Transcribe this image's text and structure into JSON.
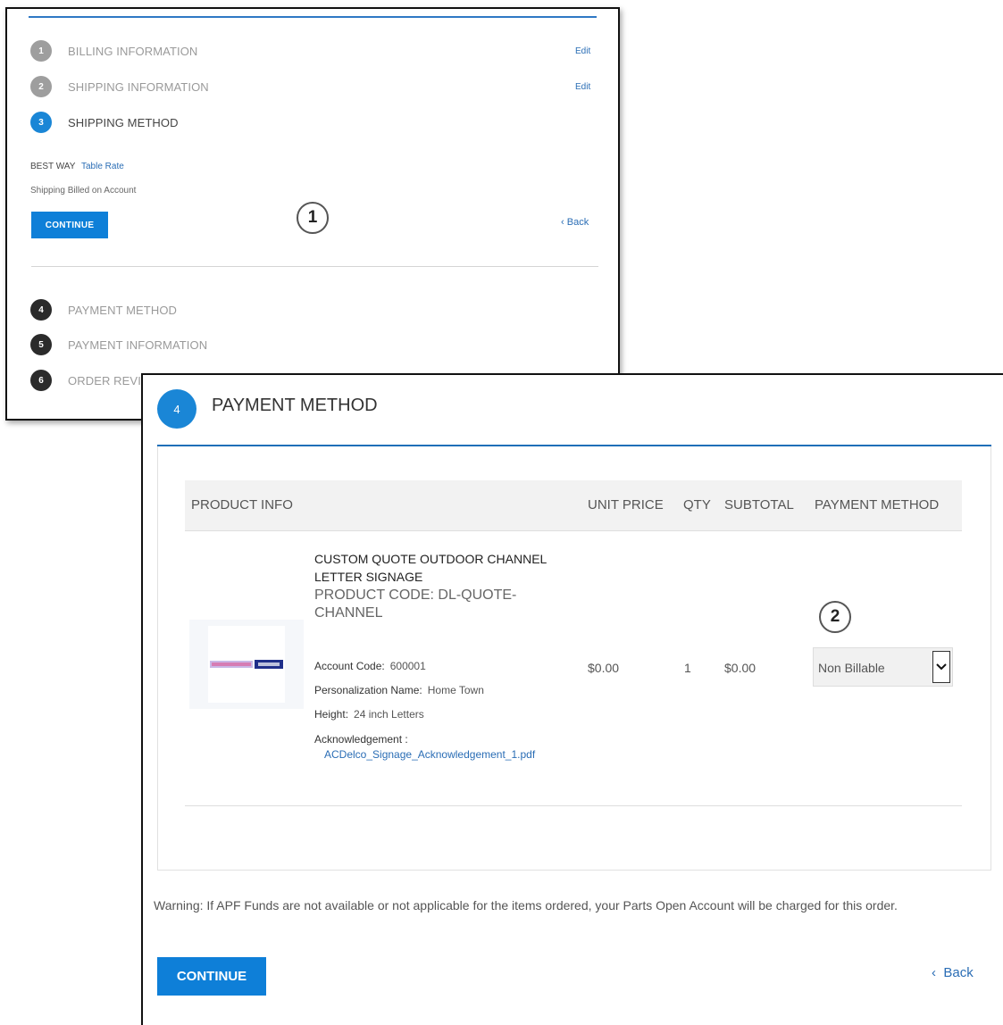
{
  "panel1": {
    "steps": [
      {
        "num": "1",
        "label": "BILLING INFORMATION",
        "edit": "Edit"
      },
      {
        "num": "2",
        "label": "SHIPPING INFORMATION",
        "edit": "Edit"
      },
      {
        "num": "3",
        "label": "SHIPPING METHOD"
      },
      {
        "num": "4",
        "label": "PAYMENT METHOD"
      },
      {
        "num": "5",
        "label": "PAYMENT INFORMATION"
      },
      {
        "num": "6",
        "label": "ORDER REVIEW"
      }
    ],
    "shipping_option": {
      "carrier": "BEST WAY",
      "rate": "Table Rate"
    },
    "shipping_note": "Shipping Billed on Account",
    "continue_label": "CONTINUE",
    "back_label": "Back",
    "callout": "1"
  },
  "panel2": {
    "step_num": "4",
    "title": "PAYMENT METHOD",
    "columns": {
      "product": "PRODUCT INFO",
      "unit_price": "UNIT PRICE",
      "qty": "QTY",
      "subtotal": "SUBTOTAL",
      "payment": "PAYMENT METHOD"
    },
    "item": {
      "name": "CUSTOM QUOTE OUTDOOR CHANNEL LETTER SIGNAGE",
      "code": "PRODUCT CODE: DL-QUOTE-CHANNEL",
      "attributes": [
        {
          "label": "Account Code:",
          "value": "600001"
        },
        {
          "label": "Personalization Name:",
          "value": "Home Town"
        },
        {
          "label": "Height:",
          "value": "24 inch Letters"
        },
        {
          "label": "Acknowledgement :",
          "value": ""
        }
      ],
      "attachment": "ACDelco_Signage_Acknowledgement_1.pdf",
      "unit_price": "$0.00",
      "qty": "1",
      "subtotal": "$0.00",
      "payment_selected": "Non Billable"
    },
    "callout": "2",
    "warning": "Warning: If APF Funds are not available or not applicable for the items ordered, your Parts Open Account will be charged for this order.",
    "continue_label": "CONTINUE",
    "back_label": "Back"
  },
  "colors": {
    "accent_blue": "#0e7fd8",
    "link_blue": "#2a6db5",
    "step_grey": "#9e9e9e",
    "step_black": "#2b2b2b"
  }
}
